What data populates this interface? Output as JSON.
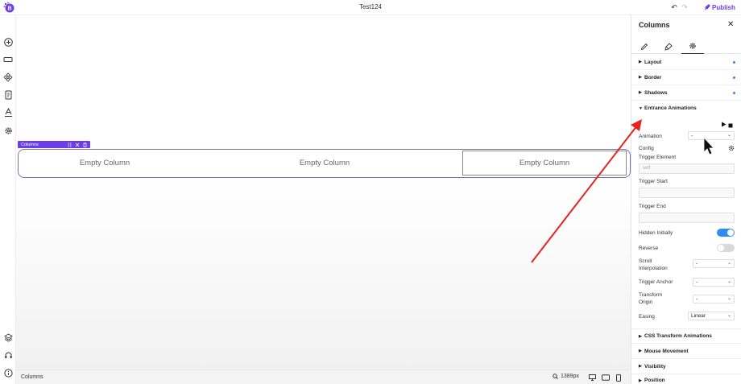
{
  "app": {
    "document_title": "Test124",
    "publish_label": "Publish",
    "accent_color": "#6b3de8"
  },
  "left_sidebar": {
    "top_icons": [
      "plus-circle-icon",
      "section-icon",
      "components-icon",
      "pages-icon",
      "typography-icon",
      "settings-gear-icon"
    ],
    "bottom_icons": [
      "layers-icon",
      "support-headset-icon",
      "info-icon"
    ]
  },
  "canvas": {
    "selection_label": "Columns",
    "columns": [
      {
        "label": "Empty Column",
        "selected": false
      },
      {
        "label": "Empty Column",
        "selected": false
      },
      {
        "label": "Empty Column",
        "selected": true
      }
    ]
  },
  "status_bar": {
    "breadcrumb": "Columns",
    "zoom": "1389px",
    "devices": [
      "desktop-icon",
      "tablet-icon",
      "mobile-icon"
    ]
  },
  "panel": {
    "title": "Columns",
    "tabs": [
      "edit-pencil-icon",
      "style-brush-icon",
      "settings-gear-icon"
    ],
    "active_tab": 2,
    "sections_top": [
      {
        "label": "Layout",
        "has_value": true
      },
      {
        "label": "Border",
        "has_value": true
      },
      {
        "label": "Shadows",
        "has_value": true
      }
    ],
    "open_section": {
      "label": "Entrance Animations",
      "animation_label": "Animation",
      "animation_value": "-",
      "config_label": "Config",
      "trigger_element_label": "Trigger Element",
      "trigger_element_placeholder": "self",
      "trigger_start_label": "Trigger Start",
      "trigger_end_label": "Trigger End",
      "hidden_initially_label": "Hidden Initially",
      "hidden_initially_on": true,
      "reverse_label": "Reverse",
      "reverse_on": false,
      "scroll_interpolation_label_1": "Scroll",
      "scroll_interpolation_label_2": "Interpolation",
      "scroll_interpolation_value": "-",
      "trigger_anchor_label": "Trigger Anchor",
      "trigger_anchor_value": "-",
      "transform_origin_label_1": "Transform",
      "transform_origin_label_2": "Origin",
      "transform_origin_value": "-",
      "easing_label": "Easing",
      "easing_value": "Linear"
    },
    "sections_bottom": [
      {
        "label": "CSS Transform Animations"
      },
      {
        "label": "Mouse Movement"
      },
      {
        "label": "Visibility"
      },
      {
        "label": "Position"
      }
    ],
    "toggle_on_color": "#2f8cf0",
    "toggle_off_color": "#d9d9d9"
  },
  "annotation": {
    "arrow_color": "#e8231f"
  }
}
